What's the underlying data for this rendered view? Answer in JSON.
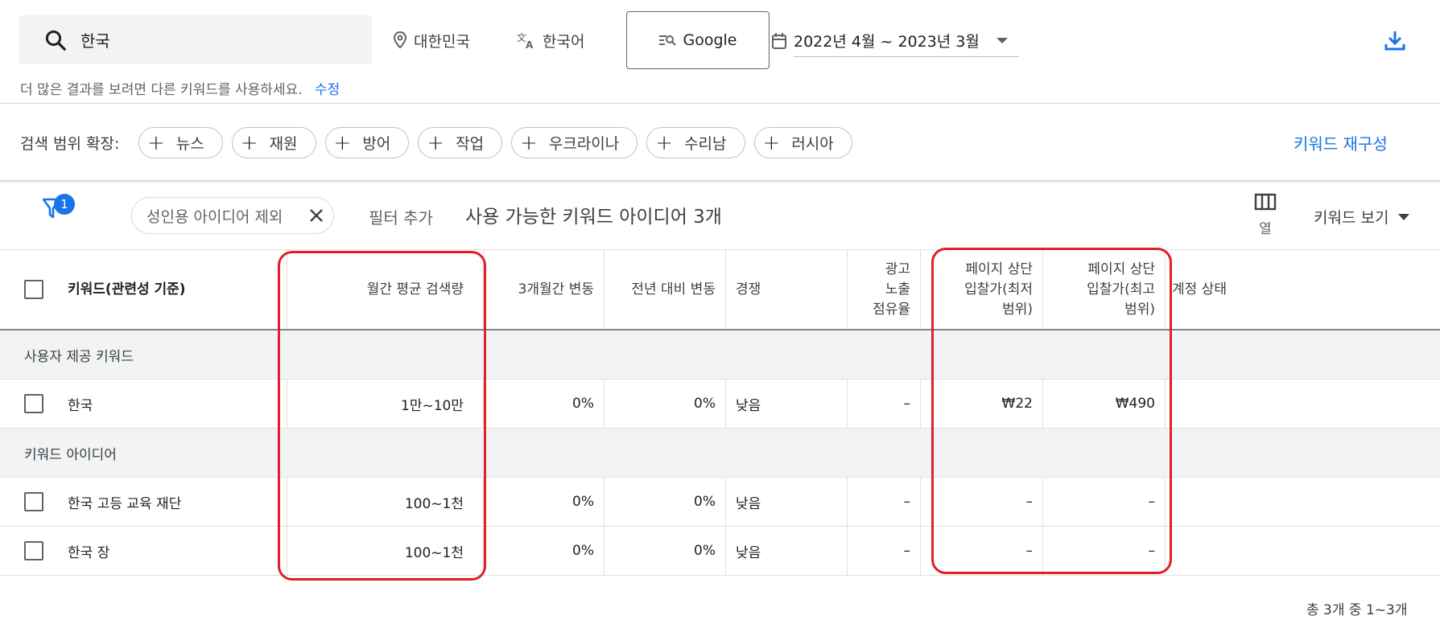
{
  "search": {
    "query": "한국"
  },
  "location": {
    "label": "대한민국"
  },
  "language": {
    "label": "한국어"
  },
  "engine": {
    "label": "Google"
  },
  "date_range": {
    "label": "2022년 4월 ~ 2023년 3월"
  },
  "hint": {
    "text": "더 많은 결과를 보려면 다른 키워드를 사용하세요.",
    "edit_label": "수정"
  },
  "broaden": {
    "label": "검색 범위 확장:",
    "chips": [
      "뉴스",
      "재원",
      "방어",
      "작업",
      "우크라이나",
      "수리남",
      "러시아"
    ],
    "refine_label": "키워드 재구성"
  },
  "filters": {
    "badge_count": "1",
    "active_filter": "성인용 아이디어 제외",
    "add_filter_label": "필터 추가",
    "ideas_count_text": "사용 가능한 키워드 아이디어 3개",
    "columns_label": "열",
    "view_label": "키워드 보기"
  },
  "table": {
    "headers": {
      "keyword": "키워드(관련성 기준)",
      "avg_searches": "월간 평균 검색량",
      "three_month": "3개월간 변동",
      "yoy": "전년 대비 변동",
      "competition": "경쟁",
      "impression_share": [
        "광고",
        "노출",
        "점유율"
      ],
      "bid_low": [
        "페이지 상단",
        "입찰가(최저",
        "범위)"
      ],
      "bid_high": [
        "페이지 상단",
        "입찰가(최고",
        "범위)"
      ],
      "account_status": "계정 상태"
    },
    "groups": [
      {
        "label": "사용자 제공 키워드",
        "rows": [
          {
            "keyword": "한국",
            "avg_searches": "1만~10만",
            "three_month": "0%",
            "yoy": "0%",
            "competition": "낮음",
            "impression_share": "–",
            "bid_low": "₩22",
            "bid_high": "₩490"
          }
        ]
      },
      {
        "label": "키워드 아이디어",
        "rows": [
          {
            "keyword": "한국 고등 교육 재단",
            "avg_searches": "100~1천",
            "three_month": "0%",
            "yoy": "0%",
            "competition": "낮음",
            "impression_share": "–",
            "bid_low": "–",
            "bid_high": "–"
          },
          {
            "keyword": "한국 장",
            "avg_searches": "100~1천",
            "three_month": "0%",
            "yoy": "0%",
            "competition": "낮음",
            "impression_share": "–",
            "bid_low": "–",
            "bid_high": "–"
          }
        ]
      }
    ]
  },
  "pagination": {
    "text": "총 3개 중 1~3개"
  },
  "colors": {
    "accent": "#1a73e8",
    "highlight": "#e0202a"
  }
}
